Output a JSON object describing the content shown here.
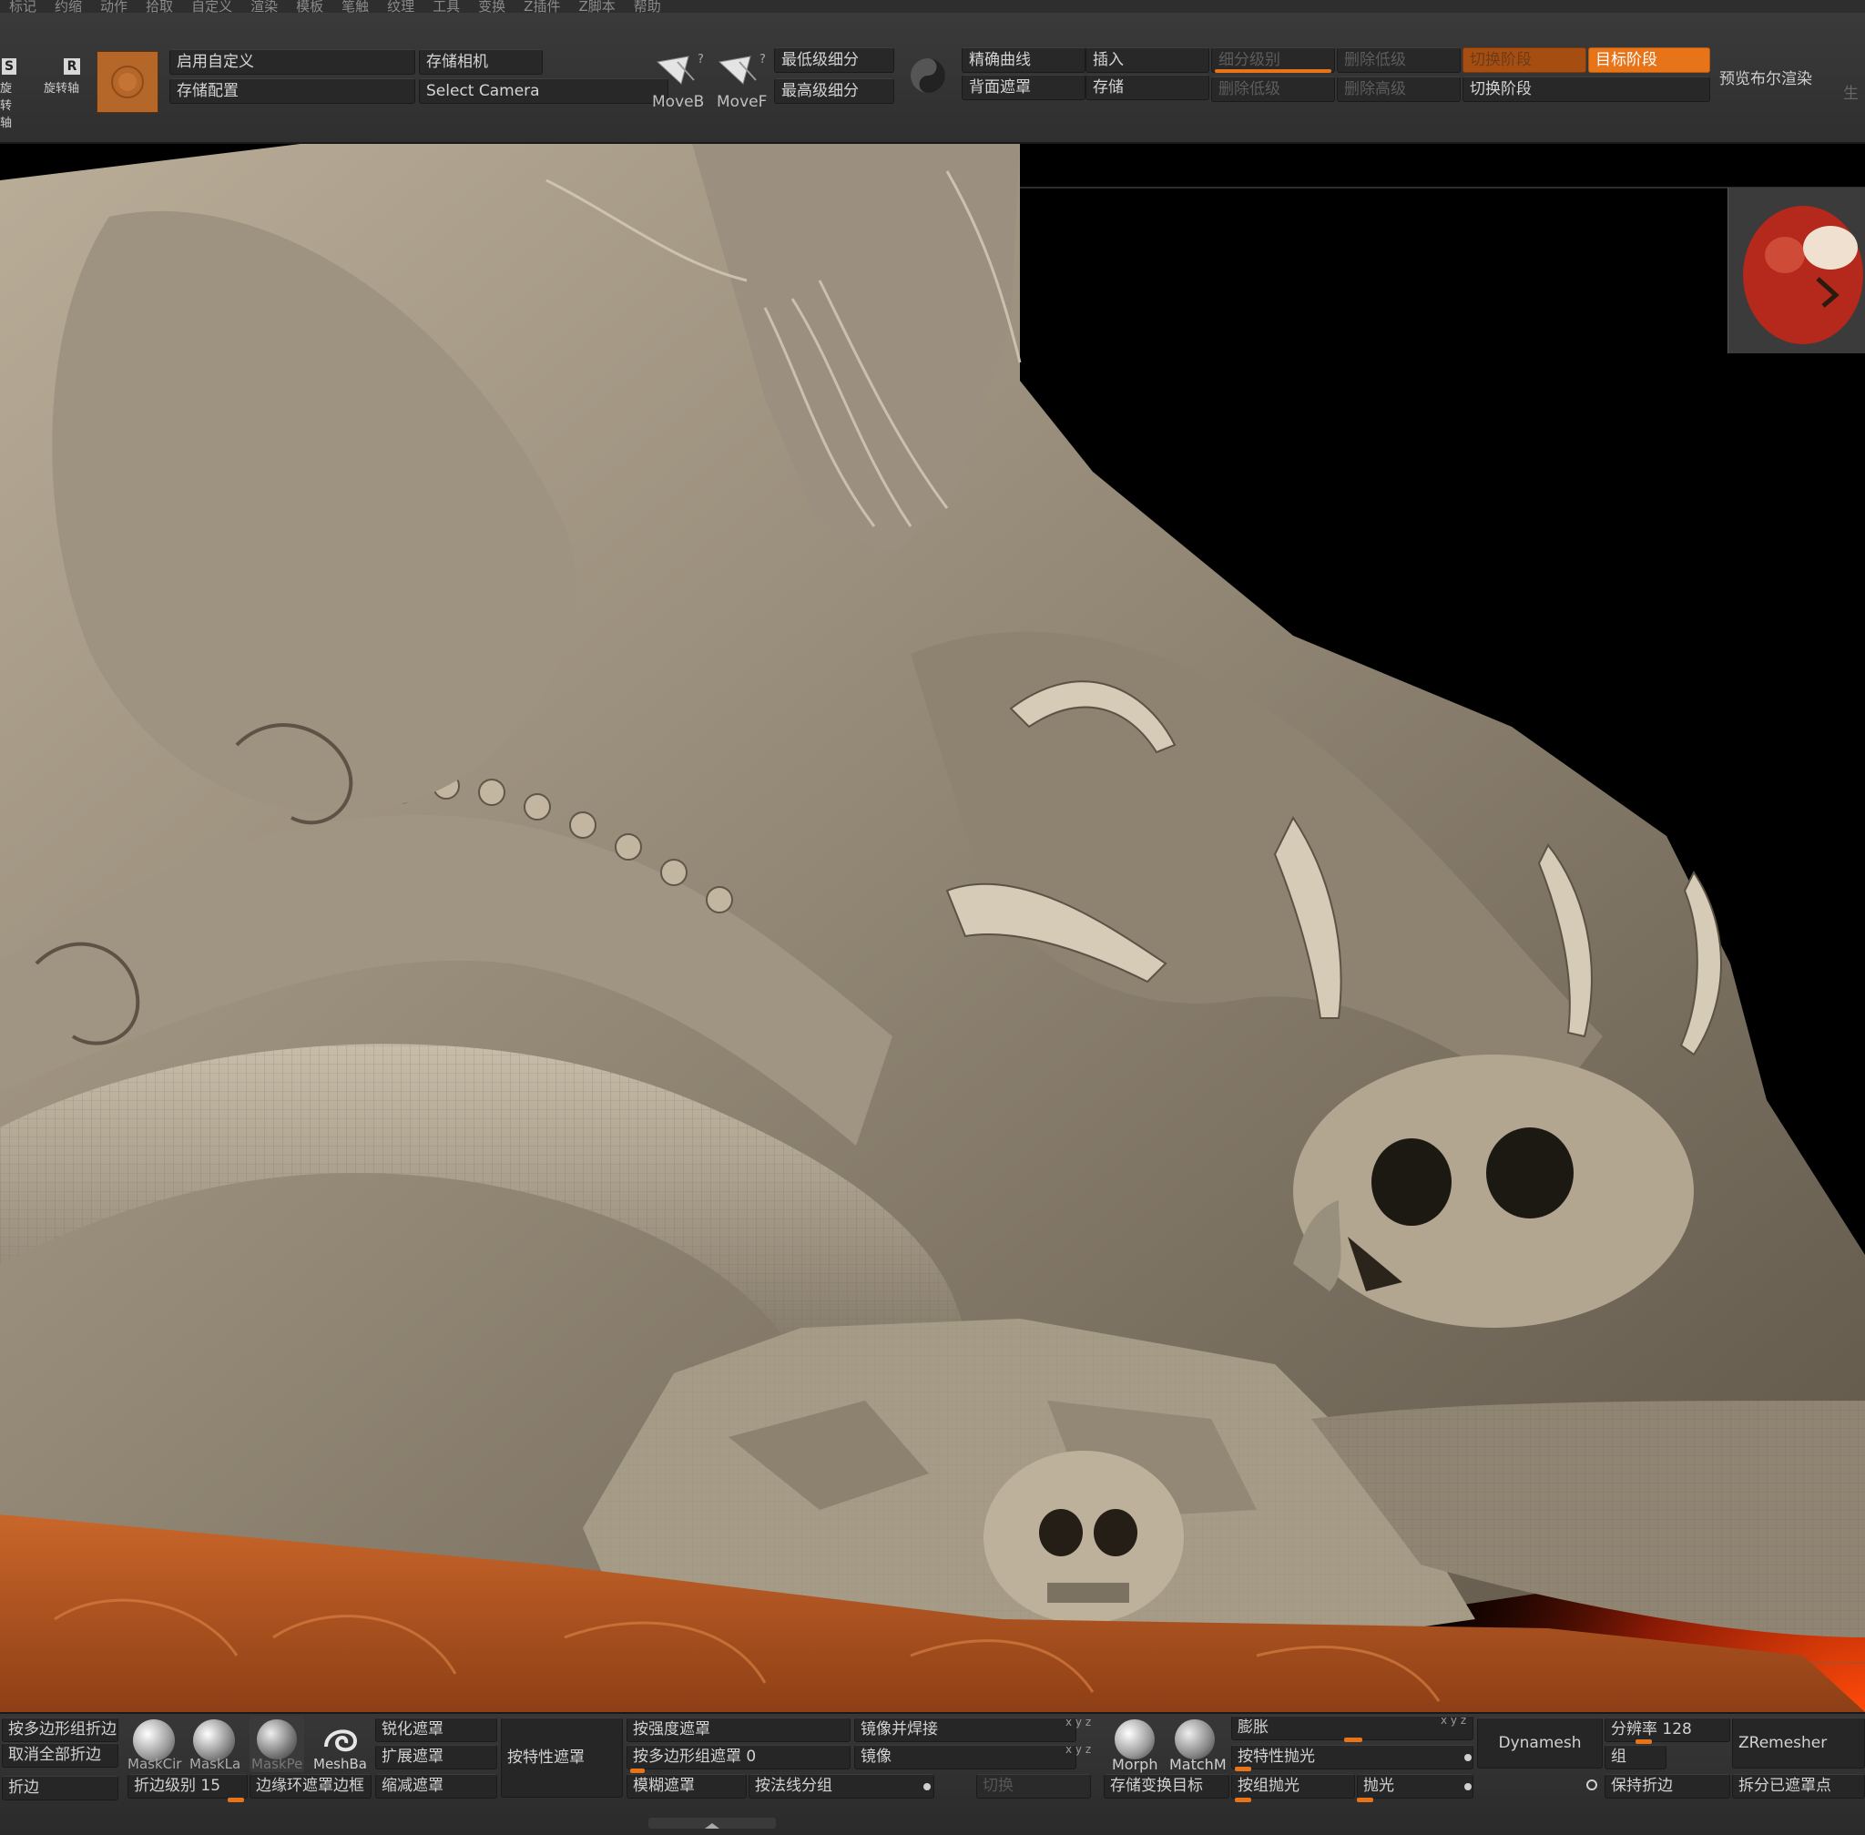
{
  "menubar": {
    "items": [
      "标记",
      "约缩",
      "动作",
      "拾取",
      "自定义",
      "渲染",
      "模板",
      "笔触",
      "纹理",
      "工具",
      "变换",
      "Z插件",
      "Z脚本",
      "帮助"
    ]
  },
  "topshelf": {
    "axis_buttons": [
      {
        "letter": "S",
        "label": "旋转轴"
      },
      {
        "letter": "R",
        "label": "旋转轴"
      }
    ],
    "enable_custom": "启用自定义",
    "save_config": "存储配置",
    "save_camera": "存储相机",
    "select_camera": "Select Camera",
    "moveb_label": "MoveB",
    "movef_label": "MoveF",
    "lowest_subdiv": "最低级细分",
    "highest_subdiv": "最高级细分",
    "precise_curve": "精确曲线",
    "backface_mask": "背面遮罩",
    "insert": "插入",
    "store": "存储",
    "subdiv_level": "细分级别",
    "del_lower": "删除低级",
    "del_lower_2": "删除低级",
    "del_higher": "删除高级",
    "switch_stage": "切换阶段",
    "target_stage": "目标阶段",
    "switch_stage_top": "切换阶段",
    "preview_bool": "预览布尔渲染",
    "edge_text": "生"
  },
  "bottomshelf": {
    "crease_by_polygroup": "按多边形组折边",
    "uncrease_all": "取消全部折边",
    "crease": "折边",
    "brush_labels": [
      "MaskCir",
      "MaskLa",
      "MaskPe",
      "MeshBa"
    ],
    "crease_level_label": "折边级别",
    "crease_level_value": "15",
    "sharpen_mask": "锐化遮罩",
    "grow_mask": "扩展遮罩",
    "shrink_mask": "缩减遮罩",
    "edge_loop_mask_border": "边缘环遮罩边框",
    "mask_by_feature": "按特性遮罩",
    "mask_by_intensity": "按强度遮罩",
    "mask_by_polygroup_label": "按多边形组遮罩",
    "mask_by_polygroup_value": "0",
    "blur_mask": "模糊遮罩",
    "group_by_normals": "按法线分组",
    "mirror_and_weld": "镜像并焊接",
    "mirror": "镜像",
    "switch_dim": "切换",
    "morph_label": "Morph",
    "matchm_label": "MatchM",
    "store_morph_target": "存储变换目标",
    "inflate": "膨胀",
    "polish_by_features": "按特性抛光",
    "polish_by_groups": "按组抛光",
    "polish": "抛光",
    "xyz_label": "x y z",
    "dynamesh": "Dynamesh",
    "resolution_label": "分辨率",
    "resolution_value": "128",
    "group": "组",
    "keep_creases": "保持折边",
    "zremesher": "ZRemesher",
    "split_masked": "拆分已遮罩点"
  },
  "colors": {
    "accent": "#e8741a",
    "panel": "#2e2e2e",
    "button": "#282828",
    "viewport_bg": "#000000",
    "sculpt": "#a99c88",
    "mask_overlay": "#c4662d"
  }
}
